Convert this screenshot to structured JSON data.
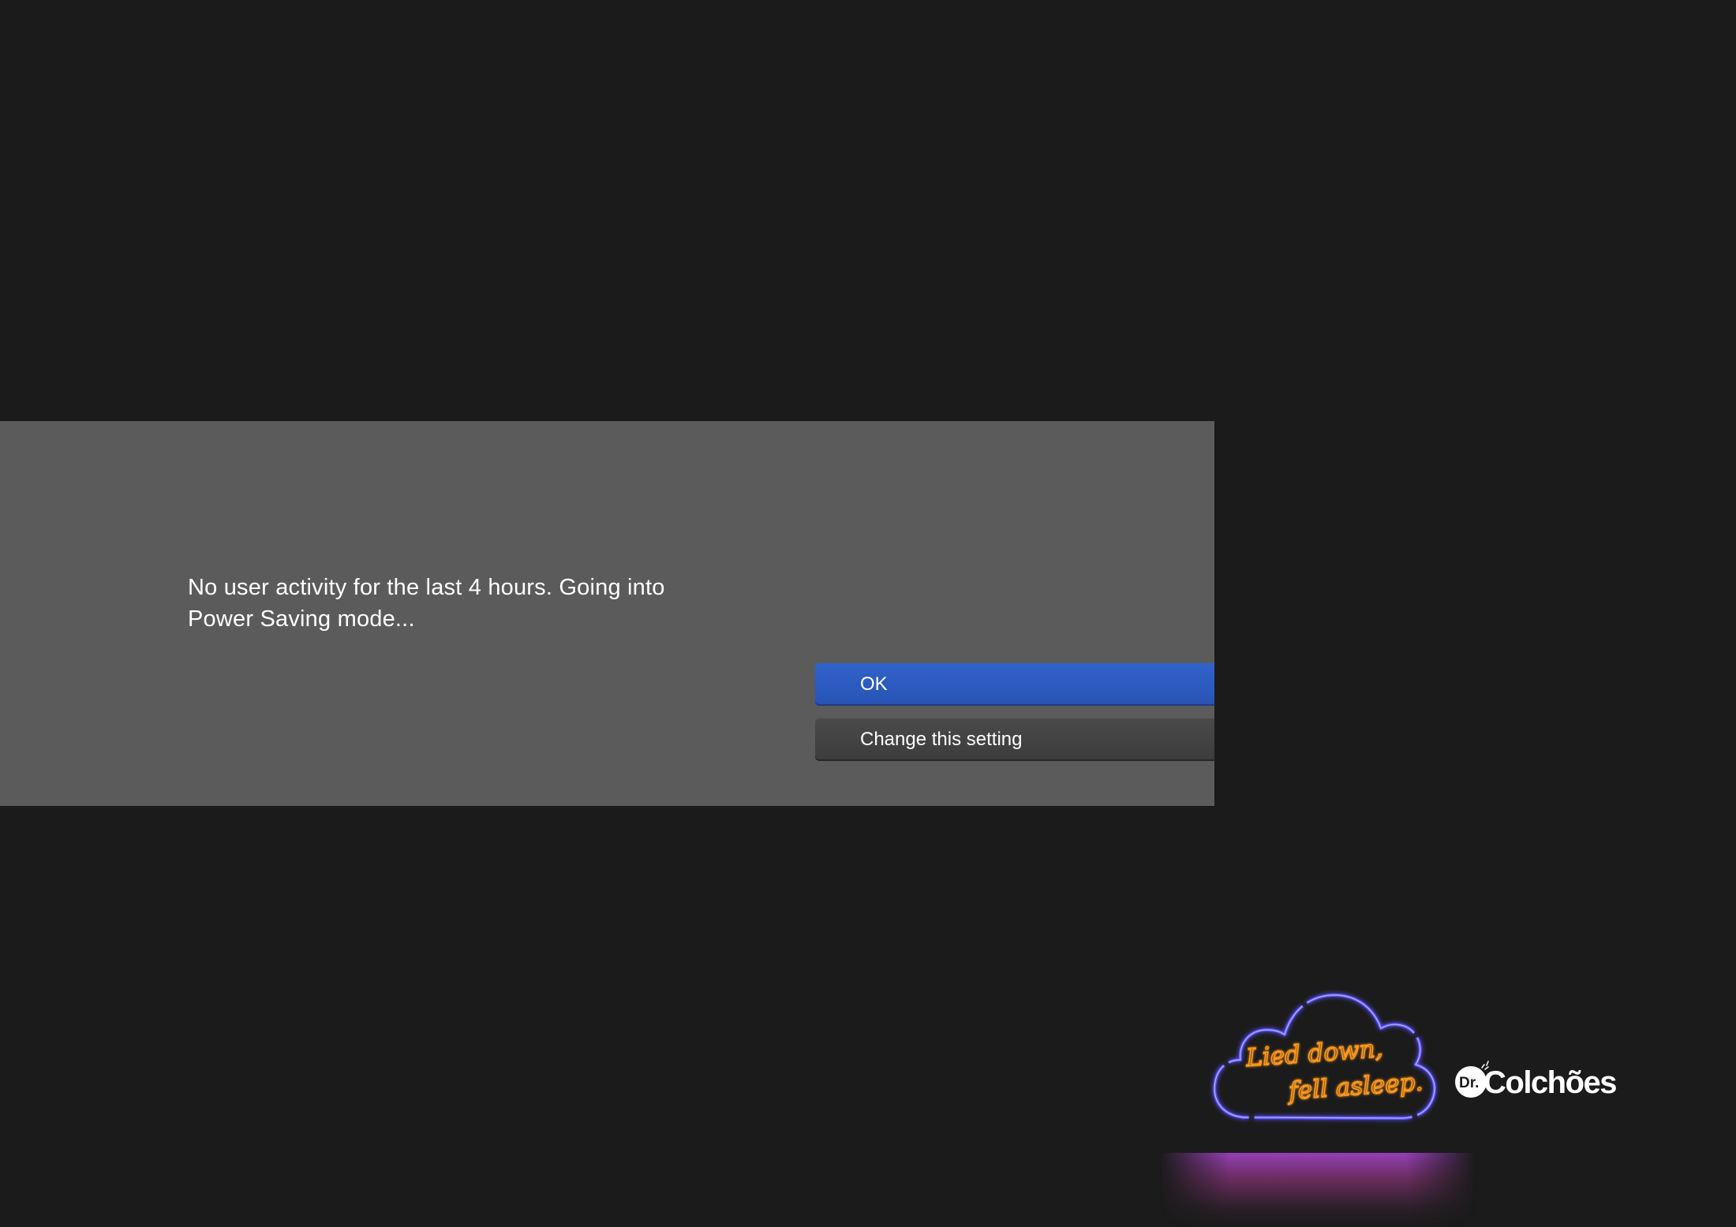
{
  "dialog": {
    "message": "No user activity for the last 4 hours. Going into Power Saving mode...",
    "ok_label": "OK",
    "change_label": "Change this setting"
  },
  "ad": {
    "tagline_line1": "Lied down,",
    "tagline_line2": "fell asleep.",
    "brand_prefix": "Dr.",
    "brand_name": "Colchões"
  },
  "colors": {
    "background": "#1b1b1b",
    "dialog_bg": "#5c5b5c",
    "primary_button": "#2f5fc6",
    "secondary_button": "#444445",
    "neon_cloud": "#5a52ff",
    "neon_text": "#ff9a1f"
  },
  "icons": {
    "neon_sign": "neon-cloud-icon",
    "brand_logo": "dr-colchoes-logo"
  }
}
